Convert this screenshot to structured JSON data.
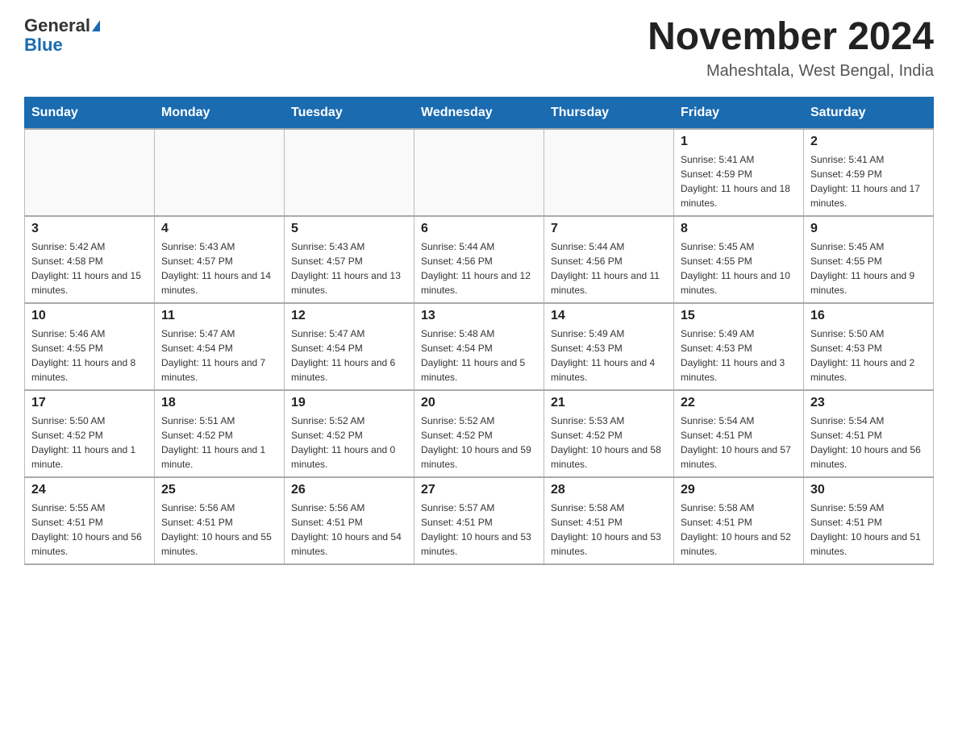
{
  "logo": {
    "general": "General",
    "blue": "Blue"
  },
  "title": "November 2024",
  "location": "Maheshtala, West Bengal, India",
  "days_of_week": [
    "Sunday",
    "Monday",
    "Tuesday",
    "Wednesday",
    "Thursday",
    "Friday",
    "Saturday"
  ],
  "weeks": [
    [
      {
        "day": "",
        "info": ""
      },
      {
        "day": "",
        "info": ""
      },
      {
        "day": "",
        "info": ""
      },
      {
        "day": "",
        "info": ""
      },
      {
        "day": "",
        "info": ""
      },
      {
        "day": "1",
        "info": "Sunrise: 5:41 AM\nSunset: 4:59 PM\nDaylight: 11 hours and 18 minutes."
      },
      {
        "day": "2",
        "info": "Sunrise: 5:41 AM\nSunset: 4:59 PM\nDaylight: 11 hours and 17 minutes."
      }
    ],
    [
      {
        "day": "3",
        "info": "Sunrise: 5:42 AM\nSunset: 4:58 PM\nDaylight: 11 hours and 15 minutes."
      },
      {
        "day": "4",
        "info": "Sunrise: 5:43 AM\nSunset: 4:57 PM\nDaylight: 11 hours and 14 minutes."
      },
      {
        "day": "5",
        "info": "Sunrise: 5:43 AM\nSunset: 4:57 PM\nDaylight: 11 hours and 13 minutes."
      },
      {
        "day": "6",
        "info": "Sunrise: 5:44 AM\nSunset: 4:56 PM\nDaylight: 11 hours and 12 minutes."
      },
      {
        "day": "7",
        "info": "Sunrise: 5:44 AM\nSunset: 4:56 PM\nDaylight: 11 hours and 11 minutes."
      },
      {
        "day": "8",
        "info": "Sunrise: 5:45 AM\nSunset: 4:55 PM\nDaylight: 11 hours and 10 minutes."
      },
      {
        "day": "9",
        "info": "Sunrise: 5:45 AM\nSunset: 4:55 PM\nDaylight: 11 hours and 9 minutes."
      }
    ],
    [
      {
        "day": "10",
        "info": "Sunrise: 5:46 AM\nSunset: 4:55 PM\nDaylight: 11 hours and 8 minutes."
      },
      {
        "day": "11",
        "info": "Sunrise: 5:47 AM\nSunset: 4:54 PM\nDaylight: 11 hours and 7 minutes."
      },
      {
        "day": "12",
        "info": "Sunrise: 5:47 AM\nSunset: 4:54 PM\nDaylight: 11 hours and 6 minutes."
      },
      {
        "day": "13",
        "info": "Sunrise: 5:48 AM\nSunset: 4:54 PM\nDaylight: 11 hours and 5 minutes."
      },
      {
        "day": "14",
        "info": "Sunrise: 5:49 AM\nSunset: 4:53 PM\nDaylight: 11 hours and 4 minutes."
      },
      {
        "day": "15",
        "info": "Sunrise: 5:49 AM\nSunset: 4:53 PM\nDaylight: 11 hours and 3 minutes."
      },
      {
        "day": "16",
        "info": "Sunrise: 5:50 AM\nSunset: 4:53 PM\nDaylight: 11 hours and 2 minutes."
      }
    ],
    [
      {
        "day": "17",
        "info": "Sunrise: 5:50 AM\nSunset: 4:52 PM\nDaylight: 11 hours and 1 minute."
      },
      {
        "day": "18",
        "info": "Sunrise: 5:51 AM\nSunset: 4:52 PM\nDaylight: 11 hours and 1 minute."
      },
      {
        "day": "19",
        "info": "Sunrise: 5:52 AM\nSunset: 4:52 PM\nDaylight: 11 hours and 0 minutes."
      },
      {
        "day": "20",
        "info": "Sunrise: 5:52 AM\nSunset: 4:52 PM\nDaylight: 10 hours and 59 minutes."
      },
      {
        "day": "21",
        "info": "Sunrise: 5:53 AM\nSunset: 4:52 PM\nDaylight: 10 hours and 58 minutes."
      },
      {
        "day": "22",
        "info": "Sunrise: 5:54 AM\nSunset: 4:51 PM\nDaylight: 10 hours and 57 minutes."
      },
      {
        "day": "23",
        "info": "Sunrise: 5:54 AM\nSunset: 4:51 PM\nDaylight: 10 hours and 56 minutes."
      }
    ],
    [
      {
        "day": "24",
        "info": "Sunrise: 5:55 AM\nSunset: 4:51 PM\nDaylight: 10 hours and 56 minutes."
      },
      {
        "day": "25",
        "info": "Sunrise: 5:56 AM\nSunset: 4:51 PM\nDaylight: 10 hours and 55 minutes."
      },
      {
        "day": "26",
        "info": "Sunrise: 5:56 AM\nSunset: 4:51 PM\nDaylight: 10 hours and 54 minutes."
      },
      {
        "day": "27",
        "info": "Sunrise: 5:57 AM\nSunset: 4:51 PM\nDaylight: 10 hours and 53 minutes."
      },
      {
        "day": "28",
        "info": "Sunrise: 5:58 AM\nSunset: 4:51 PM\nDaylight: 10 hours and 53 minutes."
      },
      {
        "day": "29",
        "info": "Sunrise: 5:58 AM\nSunset: 4:51 PM\nDaylight: 10 hours and 52 minutes."
      },
      {
        "day": "30",
        "info": "Sunrise: 5:59 AM\nSunset: 4:51 PM\nDaylight: 10 hours and 51 minutes."
      }
    ]
  ]
}
